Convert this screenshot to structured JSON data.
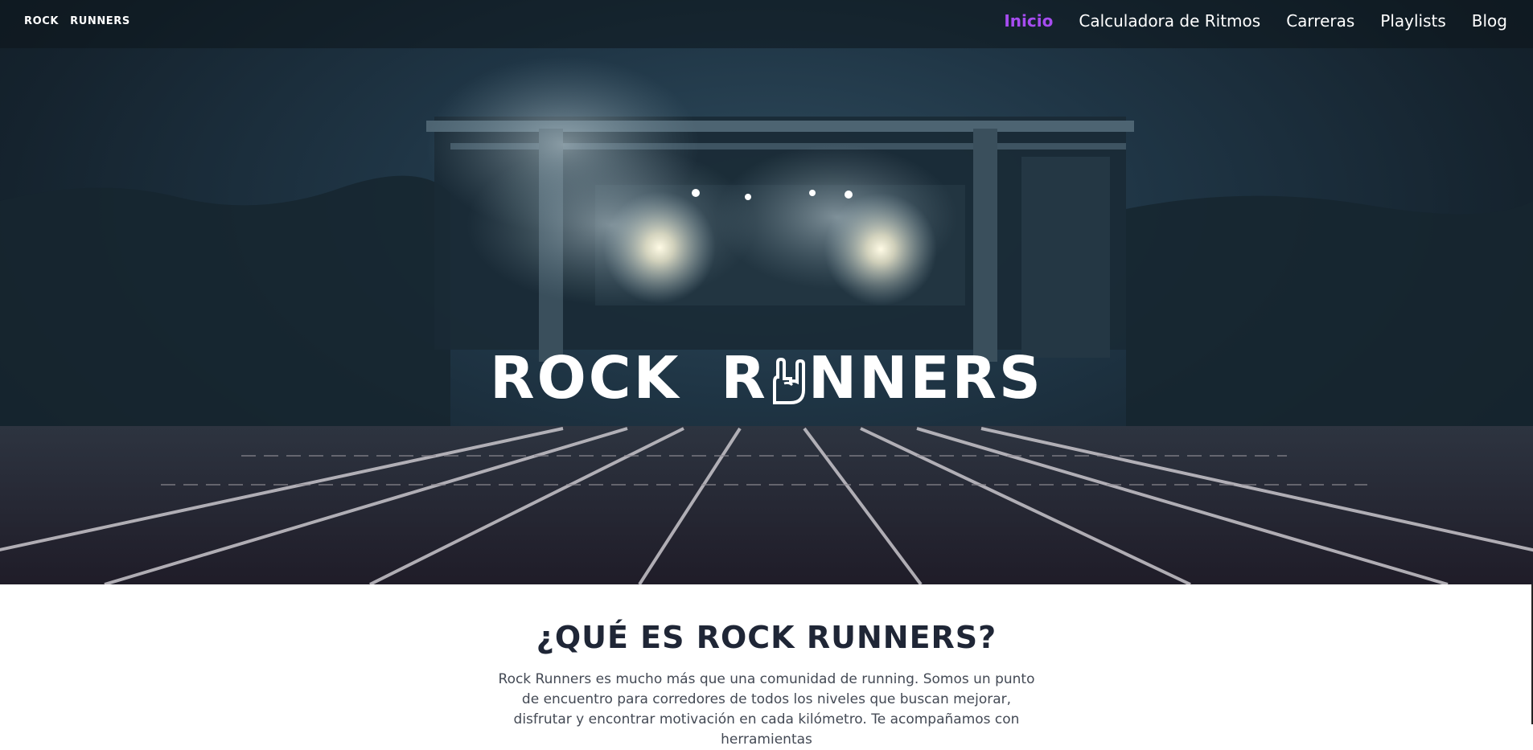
{
  "header": {
    "brand_left": "ROCK",
    "brand_right": "RUNNERS",
    "nav": [
      {
        "label": "Inicio",
        "active": true
      },
      {
        "label": "Calculadora de Ritmos",
        "active": false
      },
      {
        "label": "Carreras",
        "active": false
      },
      {
        "label": "Playlists",
        "active": false
      },
      {
        "label": "Blog",
        "active": false
      }
    ]
  },
  "hero": {
    "title_left": "ROCK",
    "title_r": "R",
    "title_right": "NNERS"
  },
  "about": {
    "heading": "¿QUÉ ES ROCK RUNNERS?",
    "paragraph": "Rock Runners es mucho más que una comunidad de running. Somos un punto de encuentro para corredores de todos los niveles que buscan mejorar, disfrutar y encontrar motivación en cada kilómetro. Te acompañamos con herramientas"
  },
  "colors": {
    "accent": "#a64cf0",
    "heading": "#1f2636",
    "text": "#444a55"
  },
  "icons": {
    "logo_glyph": "rock-hand-icon"
  }
}
